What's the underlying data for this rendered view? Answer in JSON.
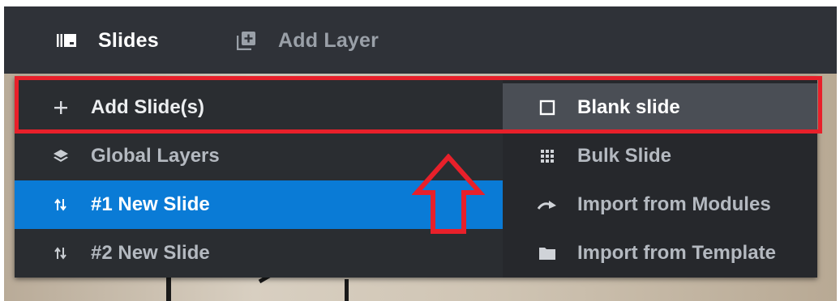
{
  "topbar": {
    "slides_label": "Slides",
    "add_layer_label": "Add Layer"
  },
  "menu": {
    "left_items": [
      {
        "label": "Add Slide(s)",
        "icon": "plus-icon"
      },
      {
        "label": "Global Layers",
        "icon": "layers-icon"
      },
      {
        "label": "#1 New Slide",
        "icon": "sort-arrows-icon",
        "selected": true
      },
      {
        "label": "#2 New Slide",
        "icon": "sort-arrows-icon"
      }
    ],
    "right_items": [
      {
        "label": "Blank slide",
        "icon": "square-outline-icon",
        "hover": true
      },
      {
        "label": "Bulk Slide",
        "icon": "grid-icon"
      },
      {
        "label": "Import from Modules",
        "icon": "redo-arrow-icon"
      },
      {
        "label": "Import from Template",
        "icon": "folder-icon"
      }
    ]
  },
  "colors": {
    "topbar_bg": "#2f3238",
    "menu_bg": "#2a2d31",
    "selected_bg": "#0a7bd6",
    "hover_bg": "#4a4e55",
    "annotation_red": "#e8202a"
  }
}
